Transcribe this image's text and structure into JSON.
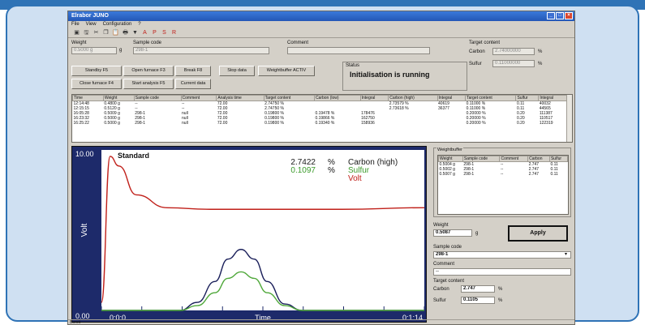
{
  "window": {
    "title": "Elrabor JUNO"
  },
  "menu": [
    "File",
    "View",
    "Configuration",
    "?"
  ],
  "toolbar_icons": [
    "new-icon",
    "save-icon",
    "cut-icon",
    "copy-icon",
    "paste-icon",
    "print-icon",
    "filter-icon",
    "a-icon",
    "p-icon",
    "s-icon",
    "r-icon"
  ],
  "toolbar_glyphs": [
    "▣",
    "🖫",
    "✂",
    "❐",
    "📋",
    "🖶",
    "▼",
    "A",
    "P",
    "S",
    "R"
  ],
  "form": {
    "weight_label": "Weight",
    "weight_value": "0.5000 g",
    "weight_unit": "g",
    "sample_code_label": "Sample code",
    "sample_code_value": "298-1",
    "comment_label": "Comment",
    "comment_value": "",
    "target_content_label": "Target content",
    "carbon_label": "Carbon",
    "carbon_value": "2.74000000",
    "carbon_unit": "%",
    "sulfur_label": "Sulfur",
    "sulfur_value": "0.11000000",
    "sulfur_unit": "%"
  },
  "buttons": {
    "standby": "Standby F5",
    "open_furnace": "Open furnace F3",
    "break": "Break F8",
    "stop_data": "Stop data",
    "weightbuffer": "Weightbuffer ACTIV",
    "close_furnace": "Close furnace F4",
    "start_analysis": "Start analysis F5",
    "current_data": "Current data"
  },
  "status": {
    "label": "Status",
    "value": "Initialisation is running"
  },
  "results": {
    "headers": [
      "Time",
      "Weight",
      "Sample code",
      "Comment",
      "Analysis time",
      "Target content",
      "Carbon (low)",
      "Integral",
      "Carbon (high)",
      "Integral",
      "Target content",
      "Sulfur",
      "Integral"
    ],
    "rows": [
      [
        "12:14:48",
        "0.4800 g",
        "--",
        "--",
        "72.00",
        "2.74750 %",
        "",
        "",
        "2.73579 %",
        "40619",
        "0.11000 %",
        "0.11",
        "40032"
      ],
      [
        "12:15:15",
        "0.5120 g",
        "--",
        "--",
        "72.00",
        "2.74750 %",
        "",
        "",
        "2.73618 %",
        "36377",
        "0.11000 %",
        "0.11",
        "44565"
      ],
      [
        "16:05:28",
        "0.5009 g",
        "298-1",
        "null",
        "72.00",
        "0.19800 %",
        "0.19478 %",
        "178476",
        "",
        "",
        "0.20000 %",
        "0.20",
        "111387"
      ],
      [
        "16:23:32",
        "0.5000 g",
        "298-1",
        "null",
        "72.00",
        "0.19800 %",
        "0.19866 %",
        "162750",
        "",
        "",
        "0.20000 %",
        "0.20",
        "110517"
      ],
      [
        "16:25:22",
        "0.5000 g",
        "298-1",
        "null",
        "72.00",
        "0.19800 %",
        "0.19340 %",
        "158936",
        "",
        "",
        "0.20000 %",
        "0.20",
        "122319"
      ]
    ]
  },
  "chart_data": {
    "type": "line",
    "title": "Standard",
    "xlabel": "Time",
    "ylabel": "Volt",
    "x_start_label": "0:0:0",
    "x_end_label": "0:1:14",
    "y_top_label": "10.00",
    "y_bottom_label": "0.00",
    "ylim": [
      0,
      10
    ],
    "readouts": [
      {
        "value": "2.7422",
        "unit": "%",
        "name": "Carbon (high)",
        "color": "#1a1a1a"
      },
      {
        "value": "0.1097",
        "unit": "%",
        "name": "Sulfur",
        "color": "#3a9a2a"
      },
      {
        "name": "Volt",
        "color": "#c0201a"
      }
    ],
    "series": [
      {
        "name": "Volt",
        "color": "#c0201a",
        "x": [
          0,
          2,
          4,
          8,
          15,
          25,
          40,
          55,
          74
        ],
        "y": [
          0.5,
          9.6,
          9.0,
          7.2,
          6.4,
          6.3,
          6.3,
          6.3,
          6.4
        ]
      },
      {
        "name": "Carbon (high)",
        "color": "#1a1f5a",
        "x": [
          0,
          18,
          22,
          26,
          29,
          32,
          35,
          38,
          42,
          46,
          74
        ],
        "y": [
          0,
          0,
          0.5,
          1.8,
          3.2,
          3.8,
          3.2,
          1.8,
          0.4,
          0,
          0
        ]
      },
      {
        "name": "Sulfur",
        "color": "#4fa83a",
        "x": [
          0,
          18,
          22,
          26,
          29,
          32,
          35,
          38,
          42,
          46,
          74
        ],
        "y": [
          0,
          0,
          0.3,
          1.1,
          2.0,
          2.4,
          2.0,
          1.1,
          0.3,
          0,
          0
        ]
      }
    ],
    "xlim": [
      0,
      74
    ],
    "background": "#ffffff",
    "frame_color": "#1d2a6a"
  },
  "weightbuffer": {
    "label": "Weightbuffer",
    "headers": [
      "Weight",
      "Sample code",
      "Comment",
      "Carbon",
      "Sulfur"
    ],
    "rows": [
      [
        "0.5004 g",
        "298-1",
        "--",
        "2.747",
        "0.11"
      ],
      [
        "0.5002 g",
        "298-1",
        "--",
        "2.747",
        "0.11"
      ],
      [
        "0.5007 g",
        "298-1",
        "--",
        "2.747",
        "0.11"
      ]
    ]
  },
  "right_panel": {
    "weight_label": "Weight",
    "weight_value": "0.5087",
    "weight_unit": "g",
    "apply_label": "Apply",
    "sample_code_label": "Sample code",
    "sample_code_value": "298-1",
    "comment_label": "Comment",
    "comment_value": "--",
    "target_content_label": "Target content",
    "carbon_label": "Carbon",
    "carbon_value": "2.747",
    "carbon_unit": "%",
    "sulfur_label": "Sulfur",
    "sulfur_value": "0.1105",
    "sulfur_unit": "%"
  },
  "statusbar": {
    "text": "Bereit"
  },
  "colors": {
    "frame": "#2f73b6",
    "card": "#cfe0f2",
    "window": "#d4d0c8"
  }
}
